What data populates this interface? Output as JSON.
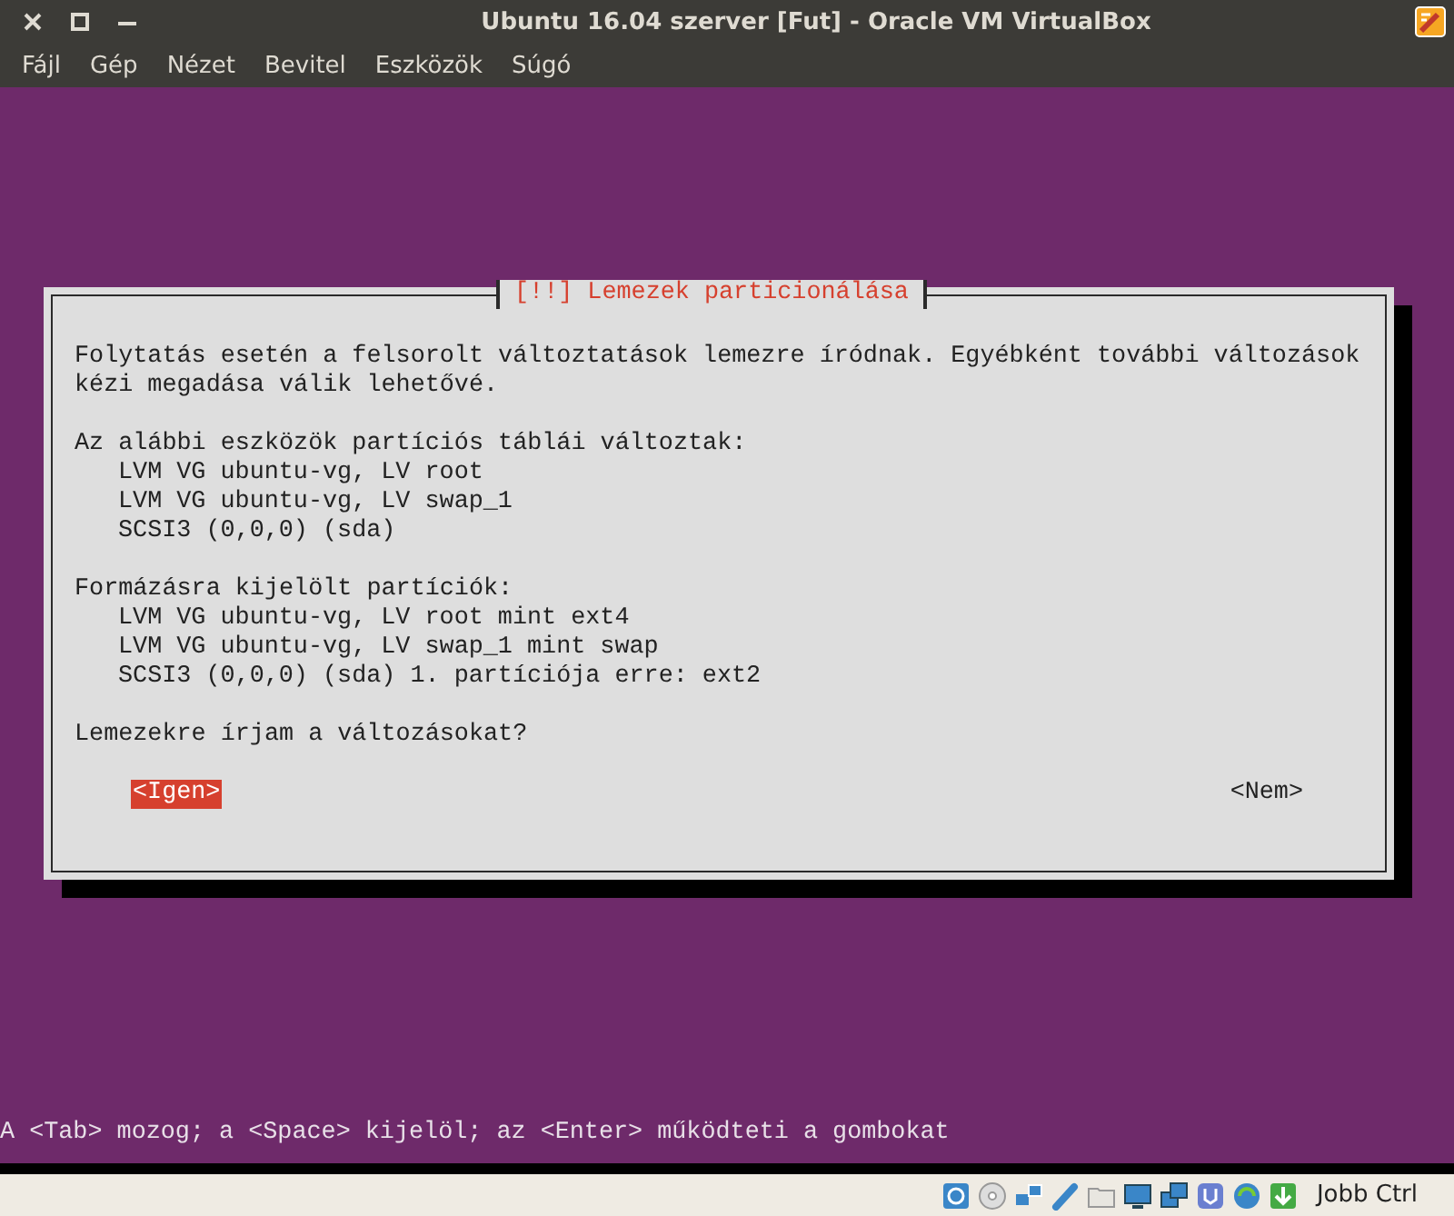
{
  "window": {
    "title": "Ubuntu 16.04 szerver [Fut] - Oracle VM VirtualBox"
  },
  "menu": [
    {
      "label": "Fájl"
    },
    {
      "label": "Gép"
    },
    {
      "label": "Nézet"
    },
    {
      "label": "Bevitel"
    },
    {
      "label": "Eszközök"
    },
    {
      "label": "Súgó"
    }
  ],
  "dialog": {
    "title": "[!!] Lemezek particionálása",
    "intro": "Folytatás esetén a felsorolt változtatások lemezre íródnak. Egyébként további változások kézi megadása válik lehetővé.",
    "sections": [
      {
        "heading": "Az alábbi eszközök partíciós táblái változtak:",
        "items": [
          "LVM VG ubuntu-vg, LV root",
          "LVM VG ubuntu-vg, LV swap_1",
          "SCSI3 (0,0,0) (sda)"
        ]
      },
      {
        "heading": "Formázásra kijelölt partíciók:",
        "items": [
          "LVM VG ubuntu-vg, LV root mint ext4",
          "LVM VG ubuntu-vg, LV swap_1 mint swap",
          "SCSI3 (0,0,0) (sda) 1. partíciója erre: ext2"
        ]
      }
    ],
    "question": "Lemezekre írjam a változásokat?",
    "buttons": [
      {
        "label": "<Igen>",
        "selected": true
      },
      {
        "label": "<Nem>",
        "selected": false
      }
    ]
  },
  "console_help": "A <Tab> mozog; a <Space> kijelöl; az <Enter> működteti a gombokat",
  "status_bar": {
    "host_key": "Jobb Ctrl"
  }
}
